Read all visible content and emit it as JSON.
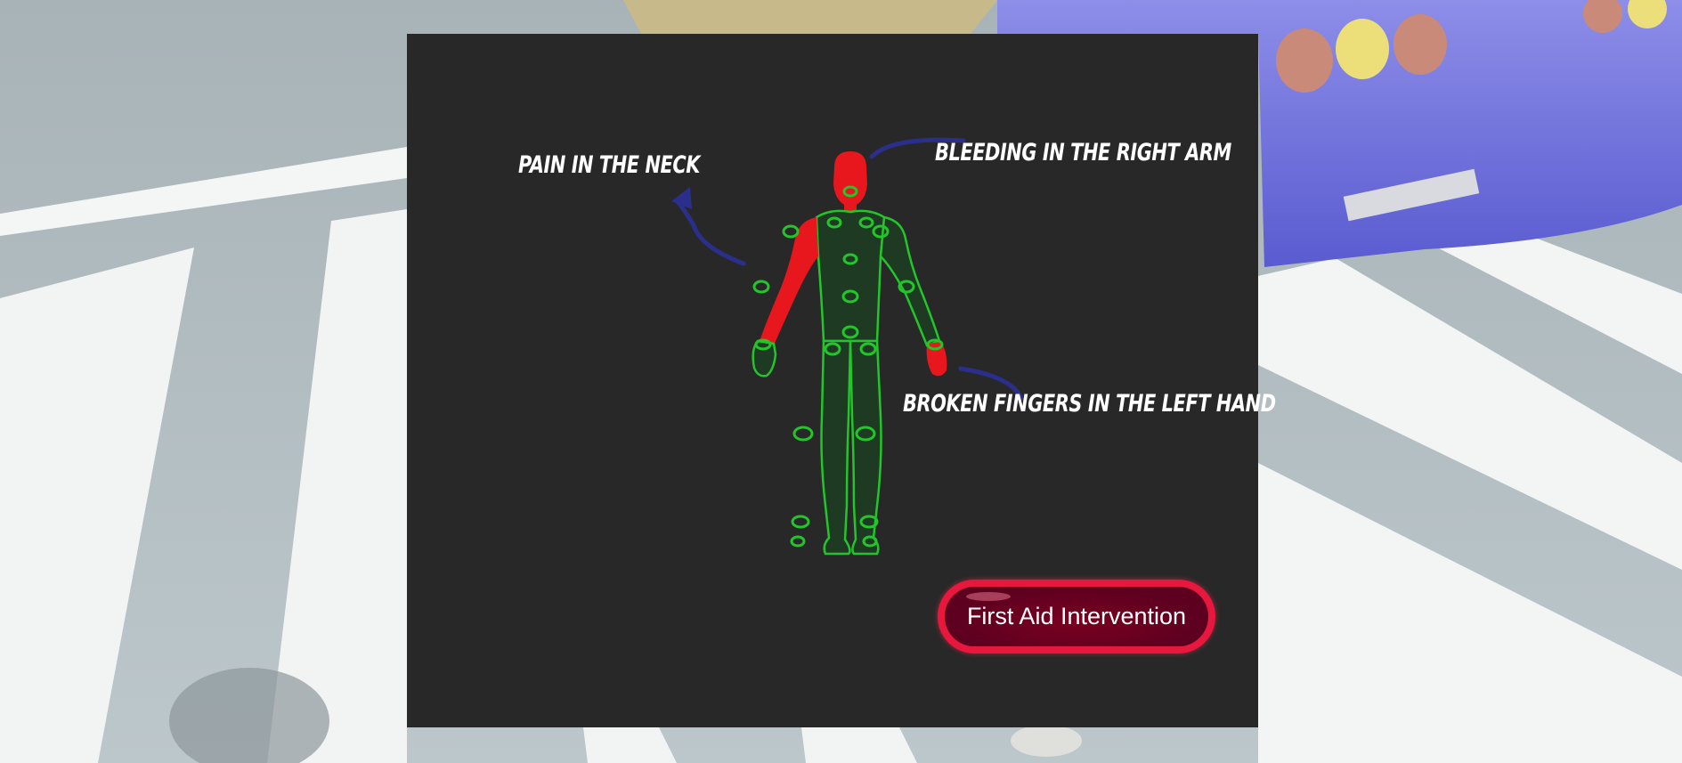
{
  "symptoms": {
    "neck": "PAIN IN THE NECK",
    "arm": "BLEEDING IN THE RIGHT ARM",
    "hand": "BROKEN FINGERS IN THE LEFT HAND"
  },
  "actions": {
    "first_aid_label": "First Aid Intervention"
  },
  "colors": {
    "panel_bg": "#282828",
    "injury": "#e8171d",
    "healthy_outline": "#22c62a",
    "arrow": "#2a2f8c",
    "button_border": "#e8173d",
    "button_fill": "#5d0020"
  }
}
